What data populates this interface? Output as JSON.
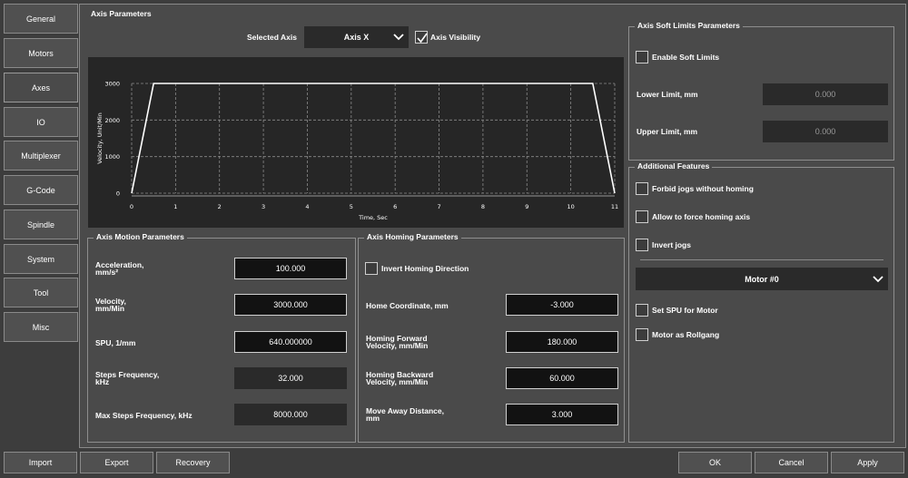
{
  "sidebar": {
    "items": [
      {
        "label": "General",
        "name": "nav-general"
      },
      {
        "label": "Motors",
        "name": "nav-motors"
      },
      {
        "label": "Axes",
        "name": "nav-axes"
      },
      {
        "label": "IO",
        "name": "nav-io"
      },
      {
        "label": "Multiplexer",
        "name": "nav-multiplexer"
      },
      {
        "label": "G-Code",
        "name": "nav-gcode"
      },
      {
        "label": "Spindle",
        "name": "nav-spindle"
      },
      {
        "label": "System",
        "name": "nav-system"
      },
      {
        "label": "Tool",
        "name": "nav-tool"
      },
      {
        "label": "Misc",
        "name": "nav-misc"
      }
    ],
    "active": "Axes"
  },
  "axis_params": {
    "title": "Axis Parameters",
    "selected_axis_label": "Selected Axis",
    "selected_axis_value": "Axis X",
    "visibility_label": "Axis Visibility",
    "visibility_checked": true
  },
  "chart_data": {
    "type": "line",
    "xlabel": "Time, Sec",
    "ylabel": "Velocity, Unit/Min",
    "xlim": [
      0,
      11
    ],
    "ylim": [
      0,
      3000
    ],
    "x_ticks": [
      "0",
      "1",
      "2",
      "3",
      "4",
      "5",
      "6",
      "7",
      "8",
      "9",
      "10",
      "11"
    ],
    "y_ticks": [
      "0",
      "1000",
      "2000",
      "3000"
    ],
    "grid": true,
    "series": [
      {
        "x": [
          0,
          0.5,
          10.5,
          11
        ],
        "y": [
          0,
          3000,
          3000,
          0
        ]
      }
    ],
    "line_color": "#ffffff",
    "grid_color": "#8a8a8a"
  },
  "motion": {
    "title": "Axis Motion Parameters",
    "rows": [
      {
        "label1": "Acceleration,",
        "label2": "mm/s²",
        "value": "100.000",
        "readonly": false
      },
      {
        "label1": "Velocity,",
        "label2": "mm/Min",
        "value": "3000.000",
        "readonly": false
      },
      {
        "label1": "SPU, 1/mm",
        "label2": "",
        "value": "640.000000",
        "readonly": false
      },
      {
        "label1": "Steps Frequency,",
        "label2": "kHz",
        "value": "32.000",
        "readonly": true
      },
      {
        "label1": "Max Steps Frequency, kHz",
        "label2": "",
        "value": "8000.000",
        "readonly": true
      }
    ]
  },
  "homing": {
    "title": "Axis Homing Parameters",
    "invert_label": "Invert Homing Direction",
    "invert_checked": false,
    "rows": [
      {
        "label1": "Home Coordinate, mm",
        "label2": "",
        "value": "-3.000"
      },
      {
        "label1": "Homing Forward",
        "label2": "Velocity, mm/Min",
        "value": "180.000"
      },
      {
        "label1": "Homing Backward",
        "label2": "Velocity, mm/Min",
        "value": "60.000"
      },
      {
        "label1": "Move Away Distance,",
        "label2": "mm",
        "value": "3.000"
      }
    ]
  },
  "soft_limits": {
    "title": "Axis Soft Limits Parameters",
    "enable_label": "Enable Soft Limits",
    "enable_checked": false,
    "lower_label": "Lower Limit, mm",
    "lower_value": "0.000",
    "upper_label": "Upper Limit, mm",
    "upper_value": "0.000"
  },
  "features": {
    "title": "Additional Features",
    "items": [
      {
        "label": "Forbid jogs without homing",
        "checked": false
      },
      {
        "label": "Allow to force homing axis",
        "checked": false
      },
      {
        "label": "Invert jogs",
        "checked": false
      }
    ],
    "motor_select": "Motor #0",
    "items2": [
      {
        "label": "Set SPU for Motor",
        "checked": false
      },
      {
        "label": "Motor as Rollgang",
        "checked": false
      }
    ]
  },
  "bottom": {
    "import": "Import",
    "export": "Export",
    "recovery": "Recovery",
    "ok": "OK",
    "cancel": "Cancel",
    "apply": "Apply"
  }
}
